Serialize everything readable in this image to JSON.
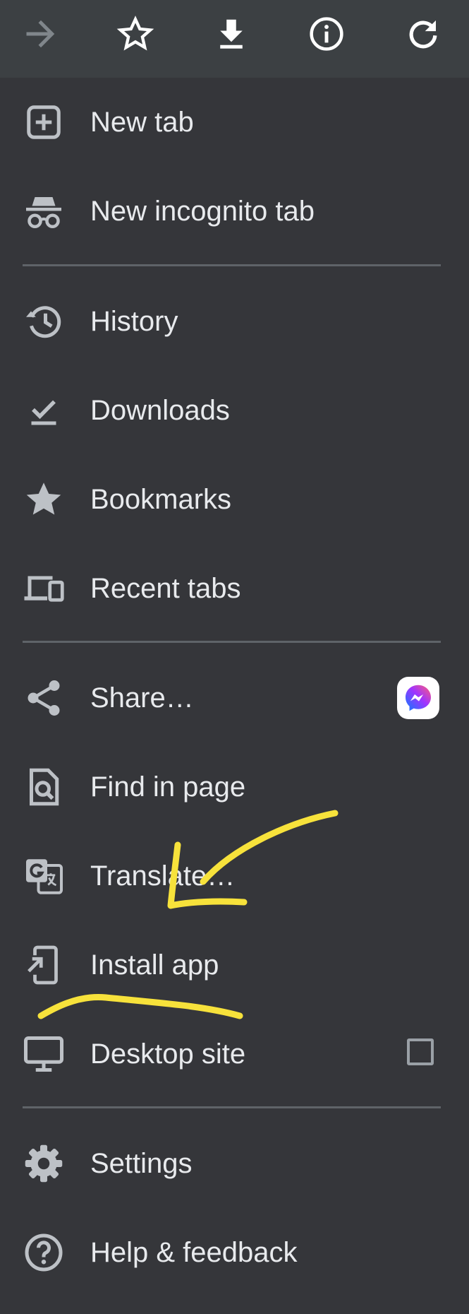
{
  "toolbar": {
    "buttons": [
      {
        "icon": "forward-arrow-icon"
      },
      {
        "icon": "star-outline-icon"
      },
      {
        "icon": "download-icon"
      },
      {
        "icon": "info-icon"
      },
      {
        "icon": "refresh-icon"
      }
    ]
  },
  "menu": {
    "new_tab": "New tab",
    "new_incognito_tab": "New incognito tab",
    "history": "History",
    "downloads": "Downloads",
    "bookmarks": "Bookmarks",
    "recent_tabs": "Recent tabs",
    "share": "Share…",
    "find_in_page": "Find in page",
    "translate": "Translate…",
    "install_app": "Install app",
    "desktop_site": "Desktop site",
    "settings": "Settings",
    "help_feedback": "Help & feedback"
  },
  "desktop_site_checked": false,
  "colors": {
    "background": "#35363a",
    "toolbar": "#3c4043",
    "text": "#e8eaed",
    "icon": "#bdc1c6",
    "annotation": "#f7e23b"
  }
}
